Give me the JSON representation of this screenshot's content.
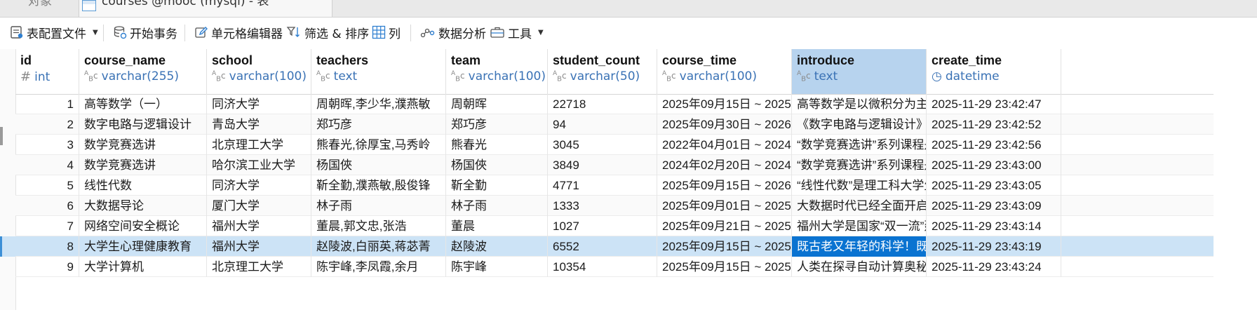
{
  "tabs": {
    "objects_label": "对象",
    "table_tab_label": "courses @mooc (mysql) - 表"
  },
  "toolbar": {
    "table_config_label": "表配置文件",
    "begin_transaction_label": "开始事务",
    "cell_editor_label": "单元格编辑器",
    "filter_sort_label": "筛选 & 排序",
    "columns_label": "列",
    "data_analysis_label": "数据分析",
    "tools_label": "工具"
  },
  "columns": [
    {
      "name": "id",
      "type": "int",
      "type_icon": "hash-icon"
    },
    {
      "name": "course_name",
      "type": "varchar(255)",
      "type_icon": "text-type-icon"
    },
    {
      "name": "school",
      "type": "varchar(100)",
      "type_icon": "text-type-icon"
    },
    {
      "name": "teachers",
      "type": "text",
      "type_icon": "text-type-icon"
    },
    {
      "name": "team",
      "type": "varchar(100)",
      "type_icon": "text-type-icon"
    },
    {
      "name": "student_count",
      "type": "varchar(50)",
      "type_icon": "text-type-icon"
    },
    {
      "name": "course_time",
      "type": "varchar(100)",
      "type_icon": "text-type-icon"
    },
    {
      "name": "introduce",
      "type": "text",
      "type_icon": "text-type-icon"
    },
    {
      "name": "create_time",
      "type": "datetime",
      "type_icon": "clock-icon"
    }
  ],
  "rows": [
    [
      "1",
      "高等数学（一）",
      "同济大学",
      "周朝晖,李少华,濮燕敏",
      "周朝晖",
      "22718",
      "2025年09月15日 ~ 2025",
      "高等数学是以微积分为主要",
      "2025-11-29 23:42:47"
    ],
    [
      "2",
      "数字电路与逻辑设计",
      "青岛大学",
      "郑巧彦",
      "郑巧彦",
      "94",
      "2025年09月30日 ~ 2026",
      "《数字电路与逻辑设计》",
      "2025-11-29 23:42:52"
    ],
    [
      "3",
      "数学竞赛选讲",
      "北京理工大学",
      "熊春光,徐厚宝,马秀岭",
      "熊春光",
      "3045",
      "2022年04月01日 ~ 2024",
      "“数学竞赛选讲”系列课程是",
      "2025-11-29 23:42:56"
    ],
    [
      "4",
      "数学竞赛选讲",
      "哈尔滨工业大学",
      "杨国俠",
      "杨国俠",
      "3849",
      "2024年02月20日 ~ 2024",
      "“数学竞赛选讲”系列课程是",
      "2025-11-29 23:43:00"
    ],
    [
      "5",
      "线性代数",
      "同济大学",
      "靳全勤,濮燕敏,殷俊锋",
      "靳全勤",
      "4771",
      "2025年09月15日 ~ 2026",
      "“线性代数”是理工科大学生",
      "2025-11-29 23:43:05"
    ],
    [
      "6",
      "大数据导论",
      "厦门大学",
      "林子雨",
      "林子雨",
      "1333",
      "2025年09月01日 ~ 2025",
      "大数据时代已经全面开启,",
      "2025-11-29 23:43:09"
    ],
    [
      "7",
      "网络空间安全概论",
      "福州大学",
      "董晨,郭文忠,张浩",
      "董晨",
      "1027",
      "2025年09月21日 ~ 2025",
      "福州大学是国家“双一流”建",
      "2025-11-29 23:43:14"
    ],
    [
      "8",
      "大学生心理健康教育",
      "福州大学",
      "赵陵波,白丽英,蒋苾菁",
      "赵陵波",
      "6552",
      "2025年09月15日 ~ 2025",
      "既古老又年轻的科学！既是",
      "2025-11-29 23:43:19"
    ],
    [
      "9",
      "大学计算机",
      "北京理工大学",
      "陈宇峰,李凤霞,余月",
      "陈宇峰",
      "10354",
      "2025年09月15日 ~ 2025",
      "人类在探寻自动计算奥秘的",
      "2025-11-29 23:43:24"
    ]
  ],
  "selection": {
    "row": "8",
    "column": "introduce"
  },
  "colors": {
    "accent": "#0a73d1",
    "selected_row": "#cce3f6",
    "selected_header": "#b7d3ee",
    "type_text": "#3a72b5"
  }
}
